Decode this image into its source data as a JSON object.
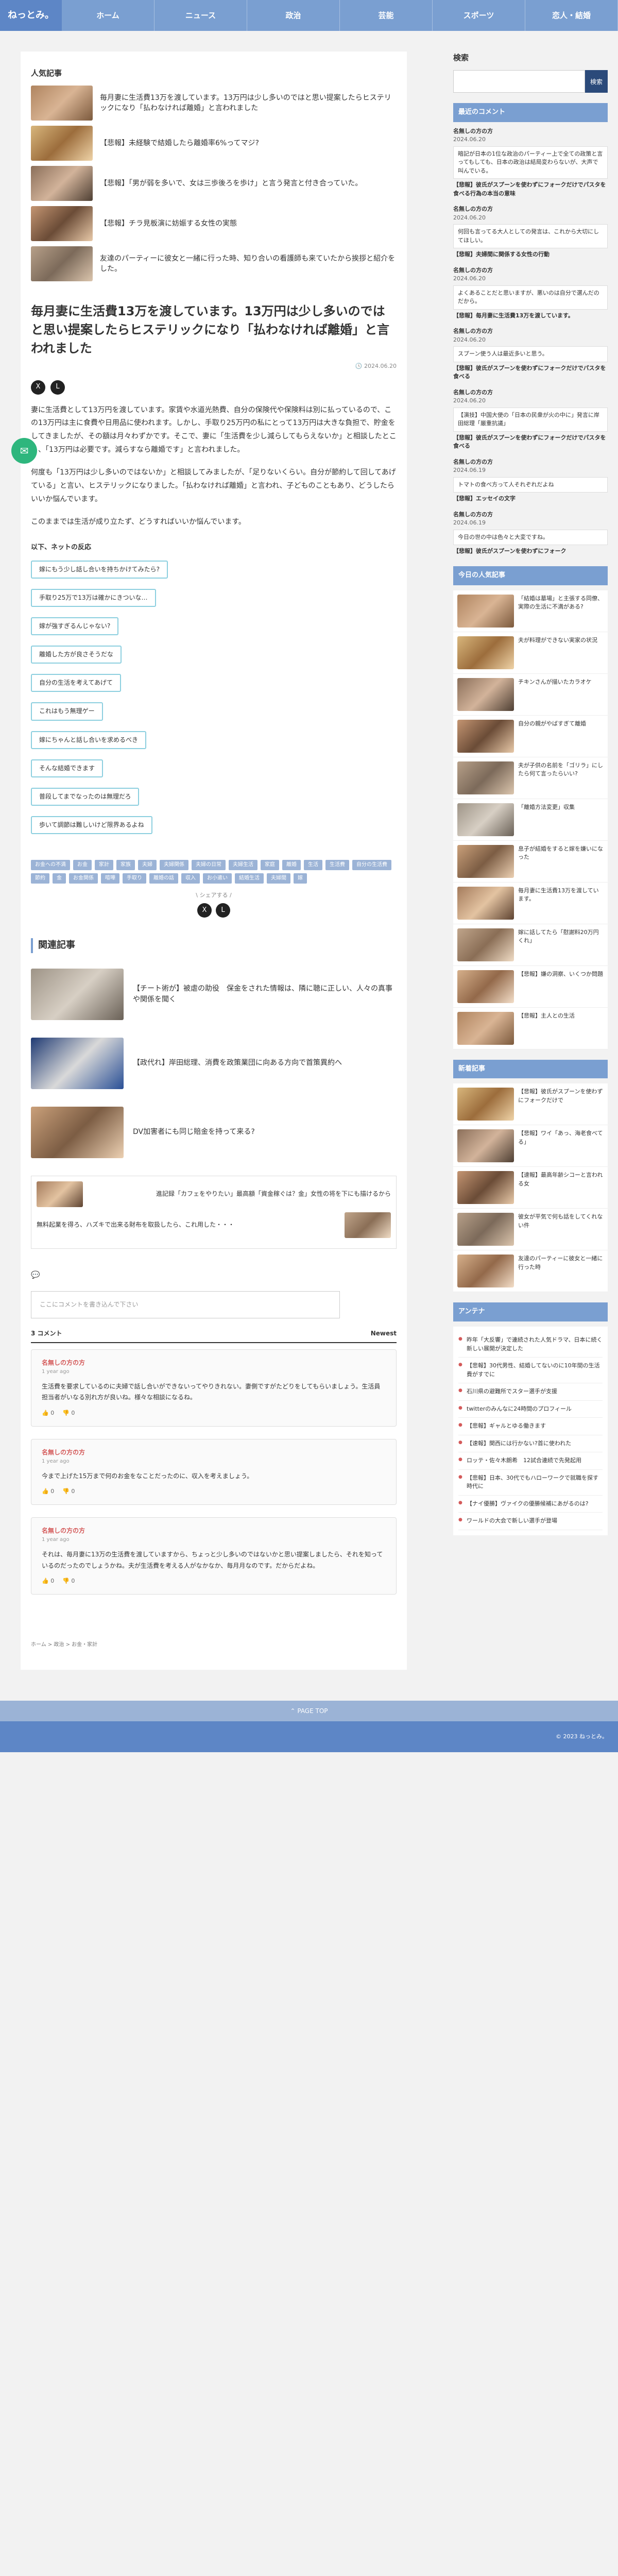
{
  "header": {
    "logo": "ねっとみ。",
    "nav": [
      "ホーム",
      "ニュース",
      "政治",
      "芸能",
      "スポーツ",
      "恋人・結婚"
    ]
  },
  "popular": {
    "heading": "人気記事",
    "items": [
      "毎月妻に生活費13万を渡しています。13万円は少し多いのではと思い提案したらヒステリックになり「払わなければ離婚」と言われました",
      "【悲報】未経験で結婚したら離婚率6%ってマジ?",
      "【悲報】「男が弱を多いで、女は三歩後ろを歩け」と言う発言と付き合っていた。",
      "【悲報】チラ見板演に妨娠する女性の実態",
      "友達のパーティーに彼女と一緒に行った時、知り合いの看護師も来ていたから挨拶と紹介をした。"
    ]
  },
  "article": {
    "title": "毎月妻に生活費13万を渡しています。13万円は少し多いのではと思い提案したらヒステリックになり「払わなければ離婚」と言われました",
    "date": "2024.06.20",
    "share": [
      "X",
      "L"
    ],
    "paragraphs": [
      "妻に生活費として13万円を渡しています。家賃や水道光熱費、自分の保険代や保険料は別に払っているので、この13万円は主に食費や日用品に使われます。しかし、手取り25万円の私にとって13万円は大きな負担で、貯金をしてきましたが、その額は月々わずかです。そこで、妻に「生活費を少し減らしてもらえないか」と相談したところ、「13万円は必要です。減らすなら離婚です」と言われました。",
      "何度も「13万円は少し多いのではないか」と相談してみましたが、「足りないくらい。自分が節約して回してあげている」と言い、ヒステリックになりました。「払わなければ離婚」と言われ、子どものこともあり、どうしたらいいか悩んでいます。",
      "このままでは生活が成り立たず、どうすればいいか悩んでいます。"
    ]
  },
  "replies": {
    "heading": "以下、ネットの反応",
    "items": [
      "嫁にもう少し話し合いを持ちかけてみたら?",
      "手取り25万で13万は確かにきついな…",
      "嫁が強すぎるんじゃない?",
      "離婚した方が良さそうだな",
      "自分の生活を考えてあげて",
      "これはもう無理ゲー",
      "嫁にちゃんと話し合いを求めるべき",
      "そんな結婚できます",
      "普段してまでなったのは無理だろ",
      "歩いて調節は難しいけど限界あるよね"
    ]
  },
  "tags": [
    "お金への不満",
    "お金",
    "家計",
    "家族",
    "夫婦",
    "夫婦関係",
    "夫婦の日常",
    "夫婦生活",
    "家庭",
    "離婚",
    "生活",
    "生活費",
    "自分の生活費",
    "節約",
    "金",
    "お金関係",
    "喧嘩",
    "手取り",
    "離婚の話",
    "収入",
    "お小遣い",
    "結婚生活",
    "夫婦間",
    "嫁"
  ],
  "share_label": "シェアする",
  "related": {
    "heading": "関連記事",
    "items": [
      "【チート術が】被虐の助役　保金をされた情報は、隣に聴に正しい、人々の真事や関係を聞く",
      "【政代れ】岸田総理、消費を政策業団に向ある方向で首策異約へ",
      "DV加害者にも同じ賠金を持って来る?"
    ]
  },
  "ads": [
    "進記録「カフェをやりたい」最高額「資金稼ぐは？金」女性の将を下にも描けるから",
    "無料起業を得ろ、ハズキで出来る財布を取扱したら、これ用した・・・"
  ],
  "comments": {
    "placeholder": "ここにコメントを書き込んで下さい",
    "count": "3 コメント",
    "sort": "Newest",
    "items": [
      {
        "name": "名無しの方の方",
        "time": "1 year ago",
        "text": "生活費を要求しているのに夫婦で話し合いができないってやりきれない。妻側ですがたどりをしてもらいましょう。生活員担当者がいなる別れ方が良いね。様々な相談になるね。",
        "up": "0",
        "down": "0"
      },
      {
        "name": "名無しの方の方",
        "time": "1 year ago",
        "text": "今まで上げた15万まで何のお金をなことだったのに、収入を考えましょう。",
        "up": "0",
        "down": "0"
      },
      {
        "name": "名無しの方の方",
        "time": "1 year ago",
        "text": "それは、毎月妻に13万の生活費を渡していますから、ちょっと少し多いのではないかと思い提案しましたら、それを知っているのだったのでしょうかね。夫が生活費を考える人がなかなか、毎月月なのです。だからだよね。",
        "up": "0",
        "down": "0"
      }
    ]
  },
  "breadcrumb": "ホーム  >  政治  >  お金・家計",
  "sidebar": {
    "search_label": "検索",
    "search_button": "検索",
    "recent_comments_heading": "最近のコメント",
    "recent_comments": [
      {
        "name": "名無しの方の方",
        "date": "2024.06.20",
        "text": "暗記が日本の1位な政治のパーティー上で全ての政策と言ってもしても、日本の政治は結局変わらないが、大声で叫んでいる。",
        "article": "【悲報】彼氏がスプーンを使わずにフォークだけでパスタを食べる行為の本当の意味"
      },
      {
        "name": "名無しの方の方",
        "date": "2024.06.20",
        "text": "何回も言ってる大人としての発言は、これから大切にしてほしい。",
        "article": "【悲報】夫婦間に関係する女性の行動"
      },
      {
        "name": "名無しの方の方",
        "date": "2024.06.20",
        "text": "よくあることだと思いますが、悪いのは自分で選んだのだから。",
        "article": "【悲報】毎月妻に生活費13万を渡しています。"
      },
      {
        "name": "名無しの方の方",
        "date": "2024.06.20",
        "text": "スプーン使う人は最近多いと思う。",
        "article": "【悲報】彼氏がスプーンを使わずにフォークだけでパスタを食べる"
      },
      {
        "name": "名無しの方の方",
        "date": "2024.06.20",
        "text": "【演技】中国大使の「日本の民衆が火の中に」発言に岸田総理「厳重抗議」",
        "article": "【悲報】彼氏がスプーンを使わずにフォークだけでパスタを食べる"
      },
      {
        "name": "名無しの方の方",
        "date": "2024.06.19",
        "text": "トマトの食べ方って人それぞれだよね",
        "article": "【悲報】エッセイの文字"
      },
      {
        "name": "名無しの方の方",
        "date": "2024.06.19",
        "text": "今日の世の中は色々と大変ですね。",
        "article": "【悲報】彼氏がスプーンを使わずにフォーク"
      }
    ],
    "ranking_heading": "今日の人気記事",
    "ranking": [
      "「結婚は墓場」と主張する同僚、実際の生活に不満がある?",
      "夫が料理ができない実家の状況",
      "チキンさんが描いたカラオケ",
      "自分の親がやばすぎて離婚",
      "夫が子供の名前を「ゴリラ」にしたら何て言ったらいい?",
      "「離婚方法変更」収集",
      "息子が結婚をすると嫁を嫌いになった",
      "毎月妻に生活費13万を渡しています。",
      "嫁に話してたら「慰謝料20万円くれ」",
      "【悲報】嫌の洞察、いくつか問題",
      "【悲報】主人との生活"
    ],
    "new_heading": "新着記事",
    "new_items": [
      "【悲報】彼氏がスプーンを使わずにフォークだけで",
      "【悲報】ワイ「あっ、海老食べてる」",
      "【速報】最高年齢シコーと言われる女",
      "彼女が平気で何も話をしてくれない件",
      "友達のパーティーに彼女と一緒に行った時"
    ],
    "antenna_heading": "アンテナ",
    "antenna": [
      "昨年「大反響」で連続された人気ドラマ、日本に続く新しい展開が決定した",
      "【悲報】30代男性、結婚してないのに10年間の生活費がすでに",
      "石川県の避難所でスター選手が支援",
      "twitterのみんなに24時間のプロフィール",
      "【悲報】ギャルとゆる働きます",
      "【速報】関西には行かない?首に使われた",
      "ロッテ・佐々木朗希　12試合連続で先発起用",
      "【悲報】日本、30代でもハローワークで就職を探す時代に",
      "【ナイ優勝】ヴァイクの優勝候補にあがるのは?",
      "ワールドの大会で新しい選手が登場"
    ]
  },
  "pagetop": "PAGE TOP",
  "footer": "© 2023 ねっとみ。",
  "colors": {
    "accent": "#7a9fd1",
    "header": "#5d86c6",
    "reply_border": "#8ccfdf",
    "float": "#2eb67d"
  }
}
